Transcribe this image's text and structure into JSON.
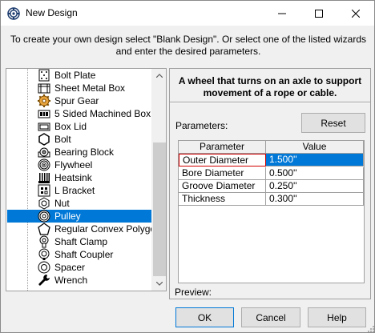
{
  "window": {
    "title": "New Design",
    "icon": "gear-app-icon",
    "controls": [
      "minimize-icon",
      "maximize-icon",
      "close-icon"
    ]
  },
  "instruction": "To create your own design select \"Blank Design\". Or select one of the listed wizards and enter the desired parameters.",
  "wizards": {
    "items": [
      {
        "label": "Bolt Plate",
        "icon": "bolt-plate-icon"
      },
      {
        "label": "Sheet Metal Box",
        "icon": "sheet-metal-box-icon"
      },
      {
        "label": "Spur Gear",
        "icon": "spur-gear-icon"
      },
      {
        "label": "5 Sided Machined Box",
        "icon": "machined-box-icon"
      },
      {
        "label": "Box Lid",
        "icon": "box-lid-icon"
      },
      {
        "label": "Bolt",
        "icon": "bolt-icon"
      },
      {
        "label": "Bearing Block",
        "icon": "bearing-block-icon"
      },
      {
        "label": "Flywheel",
        "icon": "flywheel-icon"
      },
      {
        "label": "Heatsink",
        "icon": "heatsink-icon"
      },
      {
        "label": "L Bracket",
        "icon": "l-bracket-icon"
      },
      {
        "label": "Nut",
        "icon": "nut-icon"
      },
      {
        "label": "Pulley",
        "icon": "pulley-icon"
      },
      {
        "label": "Regular Convex Polygon",
        "icon": "polygon-icon"
      },
      {
        "label": "Shaft Clamp",
        "icon": "shaft-clamp-icon"
      },
      {
        "label": "Shaft Coupler",
        "icon": "shaft-coupler-icon"
      },
      {
        "label": "Spacer",
        "icon": "spacer-icon"
      },
      {
        "label": "Wrench",
        "icon": "wrench-icon"
      }
    ],
    "selected": "Pulley"
  },
  "details": {
    "description": "A wheel that turns on an axle to support movement of a rope or cable.",
    "parameters_label": "Parameters:",
    "reset_label": "Reset",
    "grid": {
      "headers": [
        "Parameter",
        "Value"
      ],
      "rows": [
        {
          "name": "Outer Diameter",
          "value": "1.500''"
        },
        {
          "name": "Bore Diameter",
          "value": "0.500''"
        },
        {
          "name": "Groove Diameter",
          "value": "0.250''"
        },
        {
          "name": "Thickness",
          "value": "0.300''"
        }
      ],
      "selected_row": "Outer Diameter"
    },
    "preview_label": "Preview:"
  },
  "buttons": {
    "ok": "OK",
    "cancel": "Cancel",
    "help": "Help"
  },
  "colors": {
    "selection": "#0078d7",
    "focus_border": "#d00000"
  }
}
